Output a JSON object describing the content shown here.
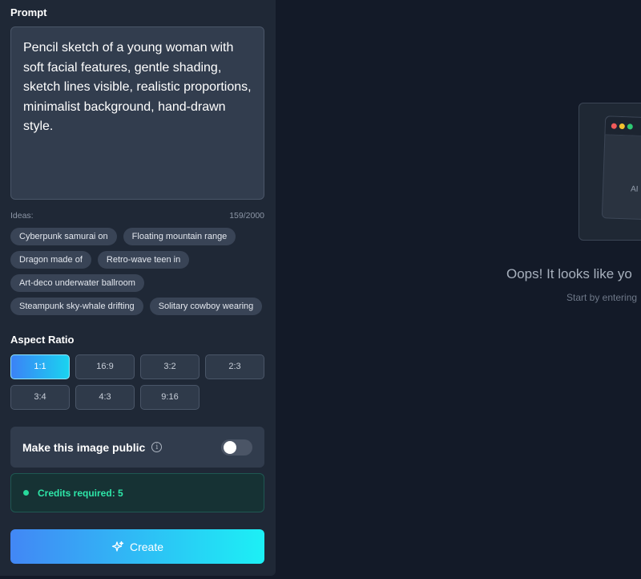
{
  "prompt": {
    "label": "Prompt",
    "value": "Pencil sketch of a young woman with soft facial features, gentle shading, sketch lines visible, realistic proportions, minimalist background, hand-drawn style."
  },
  "ideas": {
    "label": "Ideas:",
    "counter": "159/2000",
    "chips": [
      "Cyberpunk samurai on",
      "Floating mountain range",
      "Dragon made of",
      "Retro-wave teen in",
      "Art-deco underwater ballroom",
      "Steampunk sky-whale drifting",
      "Solitary cowboy wearing"
    ]
  },
  "aspect_ratio": {
    "label": "Aspect Ratio",
    "options": [
      "1:1",
      "16:9",
      "3:2",
      "2:3",
      "3:4",
      "4:3",
      "9:16"
    ],
    "selected": "1:1"
  },
  "public": {
    "label": "Make this image public",
    "enabled": false
  },
  "credits": {
    "text": "Credits required: 5",
    "accent": "#2ee6a8"
  },
  "create": {
    "label": "Create"
  },
  "empty_state": {
    "preview_text": "AI",
    "title": "Oops! It looks like yo",
    "subtitle": "Start by entering"
  },
  "colors": {
    "background": "#131a28",
    "panel": "#1f2836",
    "accent_gradient_start": "#4287f5",
    "accent_gradient_end": "#1cf0f5"
  }
}
